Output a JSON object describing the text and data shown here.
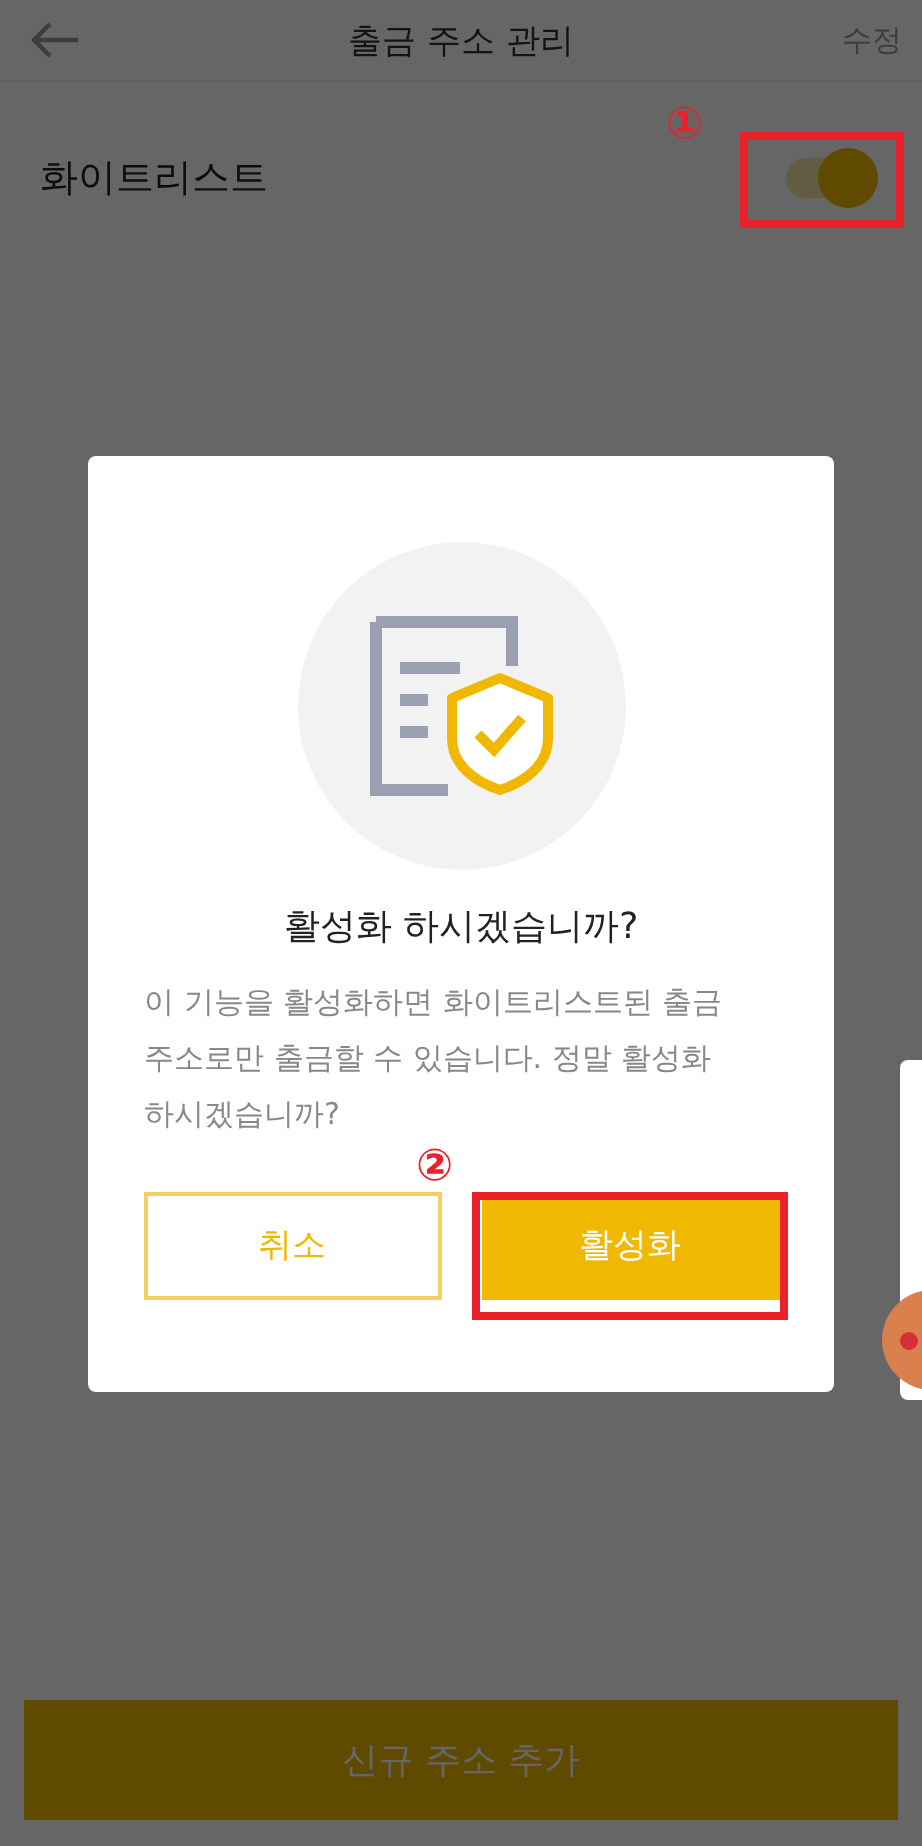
{
  "header": {
    "title": "출금 주소 관리",
    "edit": "수정"
  },
  "whitelist": {
    "label": "화이트리스트",
    "on": true
  },
  "dialog": {
    "title": "활성화 하시겠습니까?",
    "message": "이 기능을 활성화하면 화이트리스트된 출금 주소로만 출금할 수 있습니다. 정말 활성화 하시겠습니까?",
    "cancel": "취소",
    "confirm": "활성화"
  },
  "add_button": "신규 주소 추가",
  "annotations": [
    {
      "label": "①"
    },
    {
      "label": "②"
    }
  ]
}
